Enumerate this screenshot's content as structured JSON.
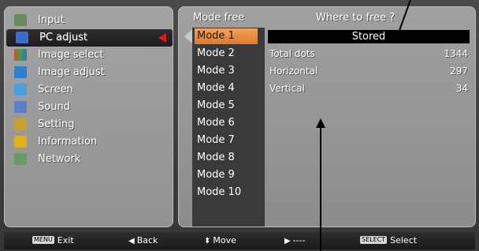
{
  "menu": {
    "items": [
      {
        "label": "Input",
        "icon": "input-icon",
        "color": "#6b8c5a"
      },
      {
        "label": "PC adjust",
        "icon": "pc-adjust-icon",
        "color": "#3d6cc4"
      },
      {
        "label": "Image select",
        "icon": "image-select-icon",
        "color": "#d84a2e"
      },
      {
        "label": "Image adjust",
        "icon": "image-adjust-icon",
        "color": "#2f7fd0"
      },
      {
        "label": "Screen",
        "icon": "screen-icon",
        "color": "#4aa0d8"
      },
      {
        "label": "Sound",
        "icon": "sound-icon",
        "color": "#5b7fc8"
      },
      {
        "label": "Setting",
        "icon": "setting-icon",
        "color": "#c8a030"
      },
      {
        "label": "Information",
        "icon": "information-icon",
        "color": "#e0b020"
      },
      {
        "label": "Network",
        "icon": "network-icon",
        "color": "#6a9a6a"
      }
    ],
    "selected_index": 1
  },
  "panel": {
    "mode_header": "Mode free",
    "where_header": "Where to free ?",
    "modes": [
      "Mode 1",
      "Mode 2",
      "Mode 3",
      "Mode 4",
      "Mode 5",
      "Mode 6",
      "Mode 7",
      "Mode 8",
      "Mode 9",
      "Mode 10"
    ],
    "selected_mode": 0,
    "stored_label": "Stored",
    "info": [
      {
        "label": "Total dots",
        "value": "1344"
      },
      {
        "label": "Horizontal",
        "value": "297"
      },
      {
        "label": "Vertical",
        "value": "34"
      }
    ]
  },
  "bottom_bar": {
    "exit_key": "MENU",
    "exit_label": "Exit",
    "back_label": "Back",
    "move_label": "Move",
    "next_label": "----",
    "select_key": "SELECT",
    "select_label": "Select"
  },
  "colors": {
    "accent": "#e88a3a",
    "selected_arrow": "#e01818"
  }
}
